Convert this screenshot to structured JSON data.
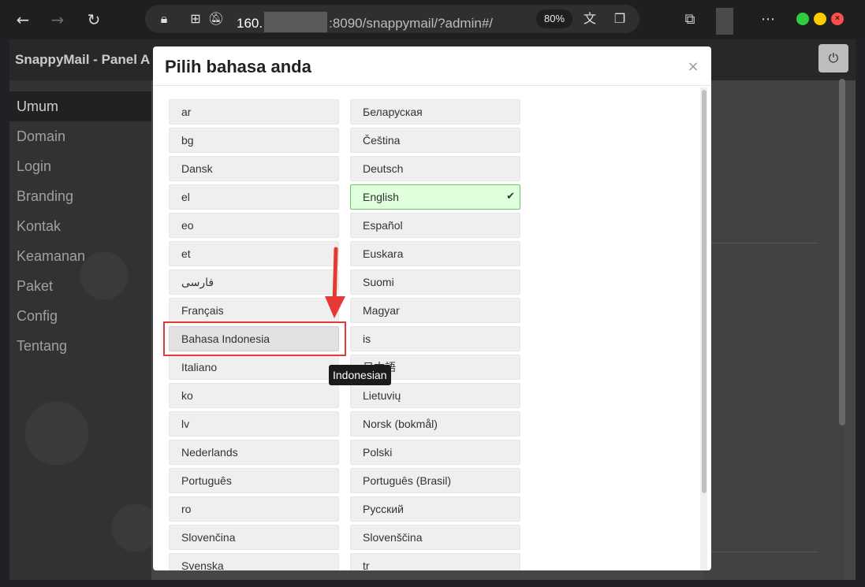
{
  "browser": {
    "address": {
      "ip_prefix": "160.",
      "url_rest": ":8090/snappymail/?admin#/",
      "zoom": "80%"
    },
    "icons": [
      "back-icon",
      "forward-icon",
      "reload-icon",
      "lock-icon",
      "site-settings-icon",
      "notifications-muted-icon",
      "translate-icon",
      "reading-list-icon",
      "extensions-icon",
      "more-icon"
    ]
  },
  "app": {
    "title": "SnappyMail - Panel A",
    "sidebar": {
      "items": [
        {
          "label": "Umum",
          "active": true
        },
        {
          "label": "Domain"
        },
        {
          "label": "Login"
        },
        {
          "label": "Branding"
        },
        {
          "label": "Kontak"
        },
        {
          "label": "Keamanan"
        },
        {
          "label": "Paket"
        },
        {
          "label": "Config"
        },
        {
          "label": "Tentang"
        }
      ]
    }
  },
  "modal": {
    "title": "Pilih bahasa anda",
    "close_symbol": "×",
    "left_column": [
      "ar",
      "bg",
      "Dansk",
      "el",
      "eo",
      "et",
      "فارسی",
      "Français",
      "Bahasa Indonesia",
      "Italiano",
      "ko",
      "lv",
      "Nederlands",
      "Português",
      "ro",
      "Slovenčina",
      "Svenska"
    ],
    "right_column": [
      "Беларуская",
      "Čeština",
      "Deutsch",
      "English",
      "Español",
      "Euskara",
      "Suomi",
      "Magyar",
      "is",
      "日本語",
      "Lietuvių",
      "Norsk (bokmål)",
      "Polski",
      "Português (Brasil)",
      "Русский",
      "Slovenščina",
      "tr"
    ],
    "selected": "English",
    "hovered": "Bahasa Indonesia",
    "tooltip": "Indonesian"
  },
  "colors": {
    "selected_bg": "#dfffdd",
    "selected_border": "#6cc36c",
    "annotation_red": "#e53935"
  }
}
